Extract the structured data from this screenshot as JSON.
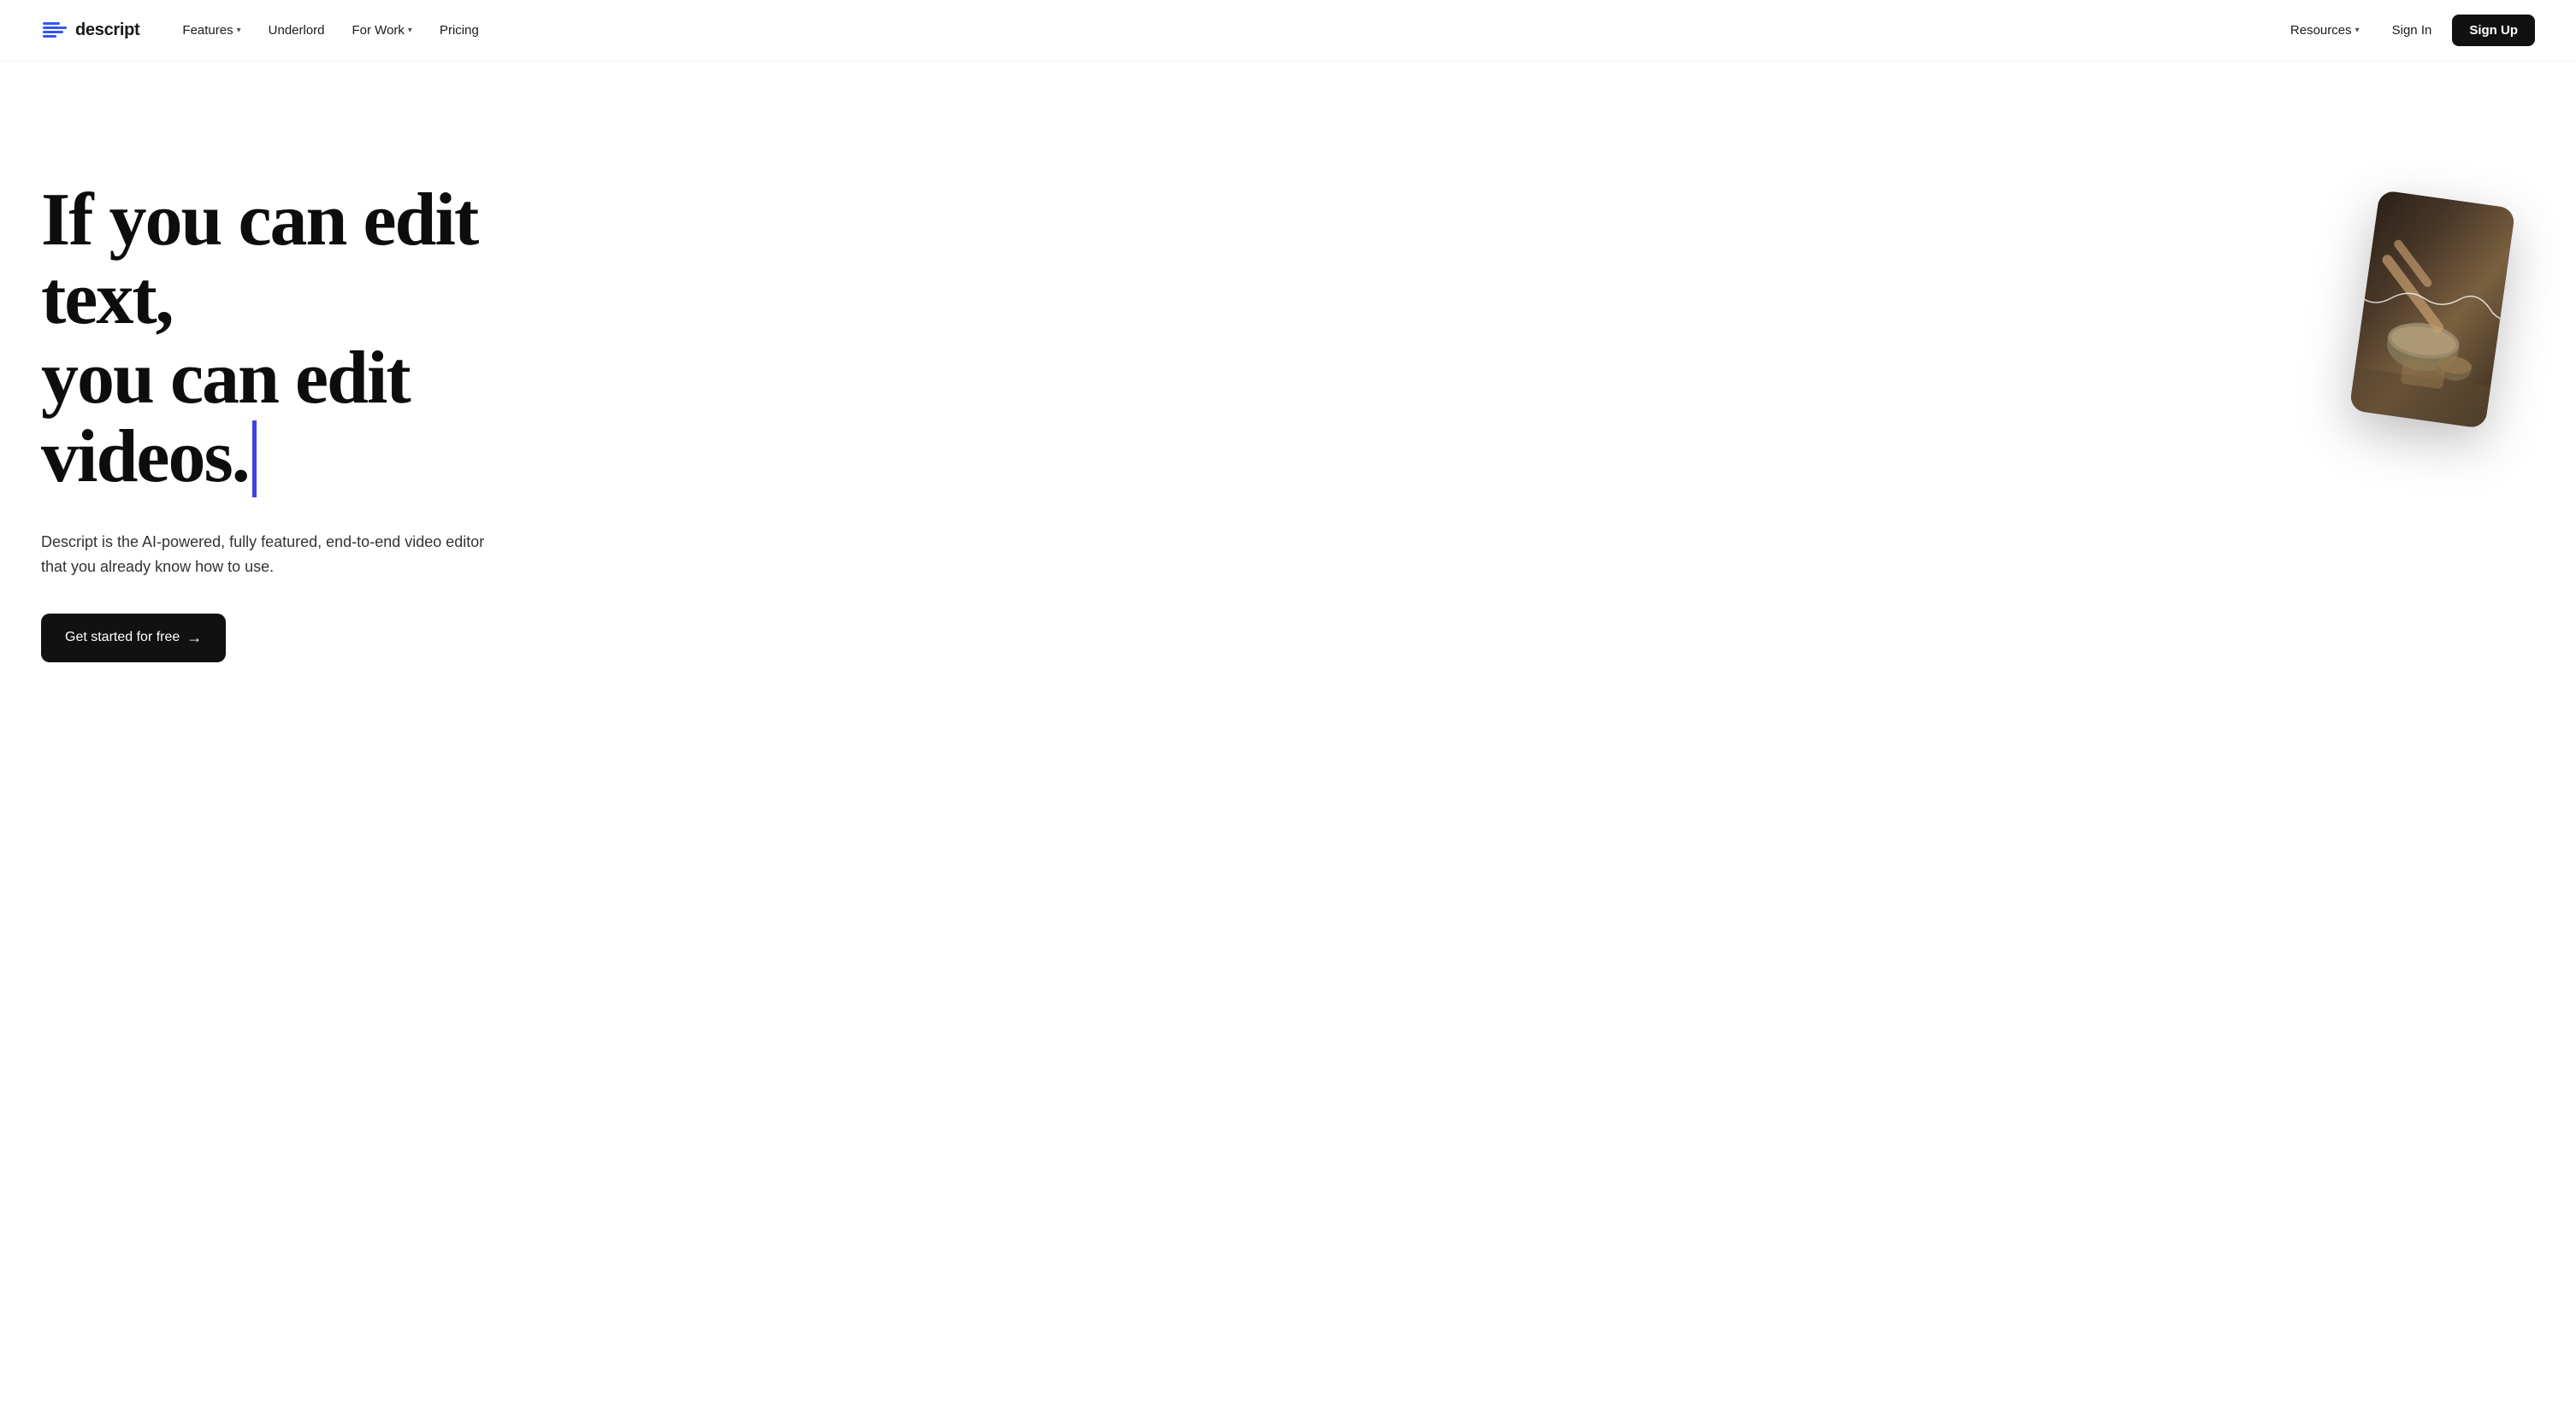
{
  "brand": {
    "name": "descript",
    "logo_alt": "Descript logo"
  },
  "nav": {
    "links": [
      {
        "id": "features",
        "label": "Features",
        "has_dropdown": true
      },
      {
        "id": "underlord",
        "label": "Underlord",
        "has_dropdown": false
      },
      {
        "id": "for-work",
        "label": "For Work",
        "has_dropdown": true
      },
      {
        "id": "pricing",
        "label": "Pricing",
        "has_dropdown": false
      }
    ],
    "right": [
      {
        "id": "resources",
        "label": "Resources",
        "has_dropdown": true
      },
      {
        "id": "sign-in",
        "label": "Sign In",
        "has_dropdown": false
      },
      {
        "id": "sign-up",
        "label": "Sign Up",
        "has_dropdown": false
      }
    ]
  },
  "hero": {
    "headline_line1": "If you can edit text,",
    "headline_line2": "you can edit videos.",
    "subtitle": "Descript is the AI-powered, fully featured, end-to-end video editor that you already know how to use.",
    "cta_label": "Get started for free",
    "cta_arrow": "→",
    "cursor_color": "#4040e8"
  }
}
